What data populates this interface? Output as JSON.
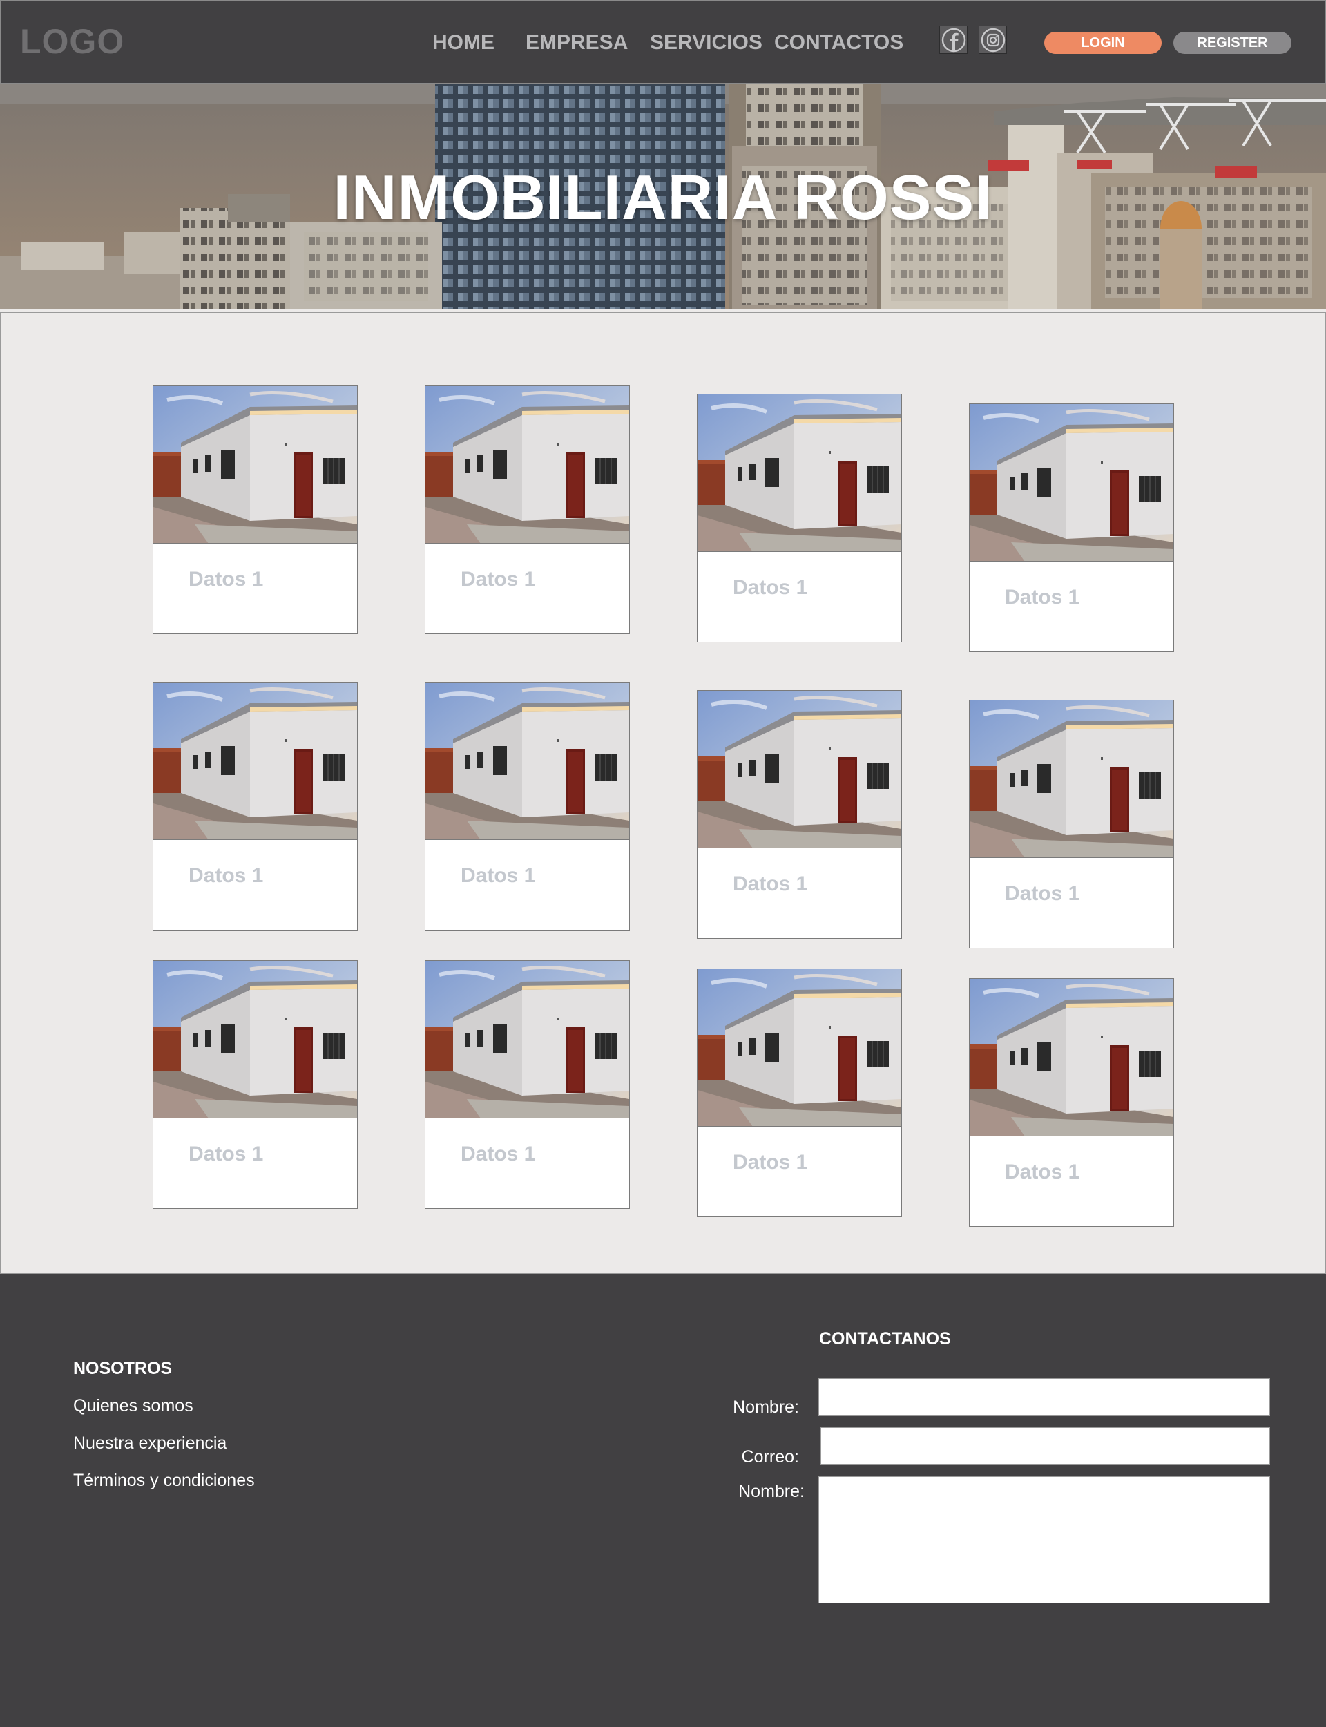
{
  "header": {
    "logo": "LOGO",
    "nav": [
      "HOME",
      "EMPRESA",
      "SERVICIOS",
      "CONTACTOS"
    ],
    "social": [
      "facebook-icon",
      "instagram-icon"
    ],
    "login_label": "LOGIN",
    "register_label": "REGISTER",
    "colors": {
      "bar": "#414042",
      "login": "#ee8a63",
      "register": "#8a898b"
    }
  },
  "hero": {
    "title": "INMOBILIARIA ROSSI"
  },
  "listings": {
    "cards": [
      {
        "label": "Datos 1"
      },
      {
        "label": "Datos 1"
      },
      {
        "label": "Datos 1"
      },
      {
        "label": "Datos 1"
      },
      {
        "label": "Datos 1"
      },
      {
        "label": "Datos 1"
      },
      {
        "label": "Datos 1"
      },
      {
        "label": "Datos 1"
      },
      {
        "label": "Datos 1"
      },
      {
        "label": "Datos 1"
      },
      {
        "label": "Datos 1"
      },
      {
        "label": "Datos 1"
      }
    ]
  },
  "footer": {
    "about": {
      "heading": "NOSOTROS",
      "links": [
        "Quienes somos",
        "Nuestra experiencia",
        "Términos y condiciones"
      ]
    },
    "contact": {
      "heading": "CONTACTANOS",
      "name_label": "Nombre:",
      "email_label": "Correo:",
      "message_label": "Nombre:",
      "name_value": "",
      "email_value": "",
      "message_value": ""
    }
  }
}
